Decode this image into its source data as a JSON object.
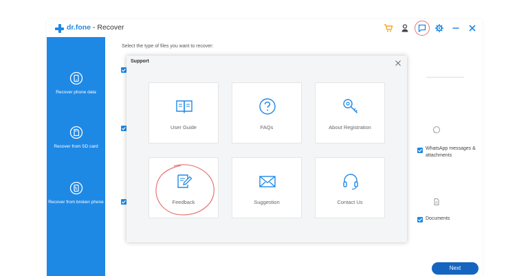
{
  "window": {
    "brand": "dr.fone",
    "separator": " - ",
    "title": "Recover"
  },
  "toolbar": {
    "icons": [
      "cart-icon",
      "user-icon",
      "feedback-icon",
      "gear-icon",
      "minimize-icon",
      "close-icon"
    ]
  },
  "sidebar": {
    "items": [
      {
        "label": "Recover phone data",
        "icon": "phone-icon"
      },
      {
        "label": "Recover from SD card",
        "icon": "sd-card-icon"
      },
      {
        "label": "Recover from broken phone",
        "icon": "broken-phone-icon"
      }
    ]
  },
  "main": {
    "prompt": "Select the type of files you want to recover:",
    "right_items": [
      {
        "label": "WhatsApp messages & attachments",
        "icon": "whatsapp-icon",
        "checked": true
      },
      {
        "label": "Documents",
        "icon": "document-icon",
        "checked": true
      }
    ],
    "next_label": "Next"
  },
  "dialog": {
    "title": "Support",
    "cards": [
      {
        "label": "User Guide",
        "icon": "book-icon"
      },
      {
        "label": "FAQs",
        "icon": "question-icon"
      },
      {
        "label": "About Registration",
        "icon": "key-icon"
      },
      {
        "label": "Feedback",
        "icon": "edit-icon"
      },
      {
        "label": "Suggestion",
        "icon": "mail-icon"
      },
      {
        "label": "Contact Us",
        "icon": "headset-icon"
      }
    ]
  },
  "colors": {
    "accent": "#1e88e5",
    "annotation": "#e57373",
    "next_button": "#1565c0"
  }
}
